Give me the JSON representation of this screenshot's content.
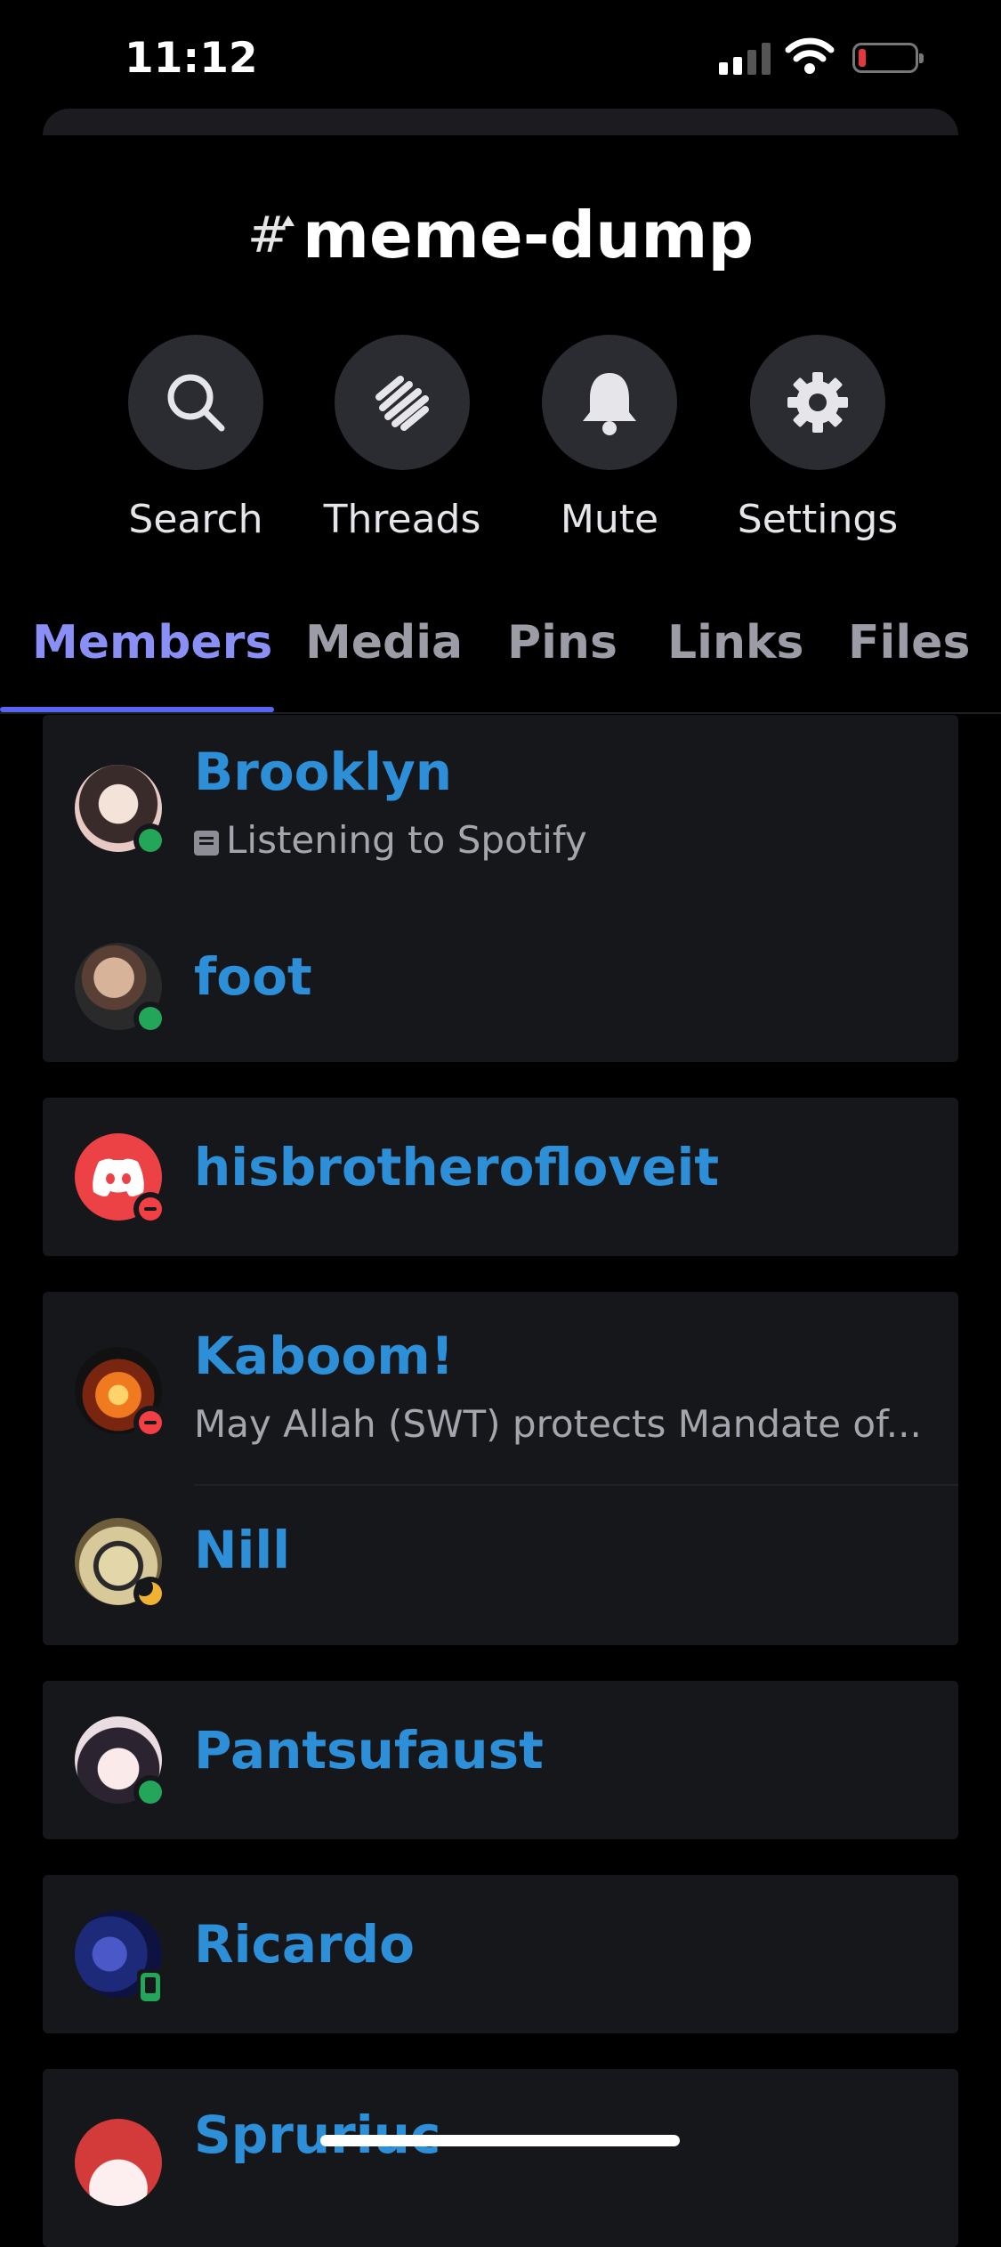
{
  "status_bar": {
    "time": "11:12"
  },
  "channel": {
    "hash_icon": "hashtag-lock-icon",
    "name": "meme-dump"
  },
  "actions": [
    {
      "label": "Search",
      "icon": "search-icon"
    },
    {
      "label": "Threads",
      "icon": "threads-icon"
    },
    {
      "label": "Mute",
      "icon": "bell-icon"
    },
    {
      "label": "Settings",
      "icon": "gear-icon"
    }
  ],
  "tabs": [
    "Members",
    "Media",
    "Pins",
    "Links",
    "Files"
  ],
  "active_tab": "Members",
  "members": [
    {
      "name": "Brooklyn",
      "status": "online",
      "activity": "Listening to Spotify"
    },
    {
      "name": "foot",
      "status": "online"
    },
    {
      "name": "hisbrotherofloveit",
      "status": "dnd"
    },
    {
      "name": "Kaboom!",
      "status": "dnd",
      "activity": "May Allah (SWT) protects Mandate of..."
    },
    {
      "name": "Nill",
      "status": "idle"
    },
    {
      "name": "Pantsufaust",
      "status": "online"
    },
    {
      "name": "Ricardo",
      "status": "mobile"
    },
    {
      "name": "Spruriuс",
      "status": "online"
    }
  ],
  "colors": {
    "accent": "#5865f2",
    "username": "#2d8fd8",
    "online": "#23a55a",
    "dnd": "#f23f43",
    "idle": "#f0b232"
  }
}
